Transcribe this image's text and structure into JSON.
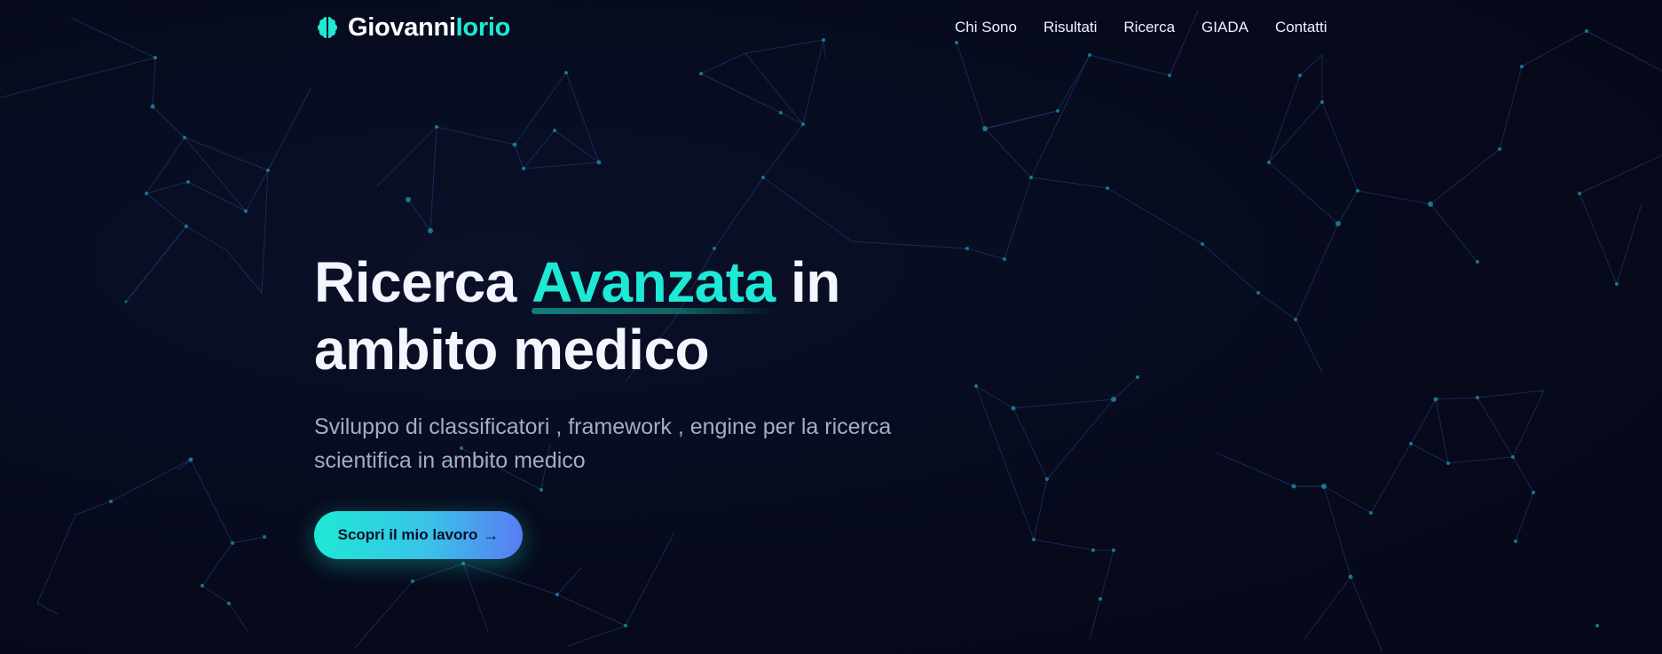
{
  "header": {
    "logo": {
      "icon": "brain-icon",
      "name_primary": "Giovanni",
      "name_accent": "Iorio"
    },
    "nav": [
      {
        "label": "Chi Sono"
      },
      {
        "label": "Risultati"
      },
      {
        "label": "Ricerca"
      },
      {
        "label": "GIADA"
      },
      {
        "label": "Contatti"
      }
    ]
  },
  "hero": {
    "title_part1": "Ricerca ",
    "title_accent": "Avanzata",
    "title_part2": " in",
    "title_line2": "ambito medico",
    "subtitle": "Sviluppo di classificatori , framework , engine per la ricerca scientifica in ambito medico",
    "cta_label": "Scopri il mio lavoro",
    "cta_icon": "arrow-right-icon"
  },
  "colors": {
    "background": "#070b1c",
    "accent": "#1de9d4",
    "cta_gradient_end": "#5a7cf5",
    "network_line": "#2a3f8a",
    "network_node": "#1d8fa8"
  }
}
